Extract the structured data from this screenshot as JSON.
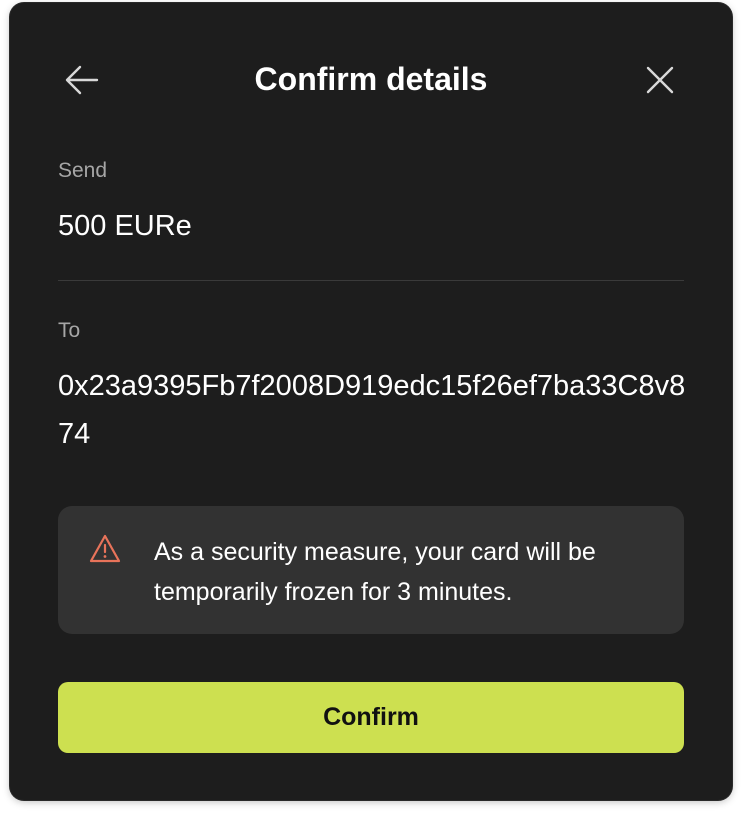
{
  "header": {
    "title": "Confirm details",
    "back_icon": "arrow-left-icon",
    "close_icon": "close-icon"
  },
  "send": {
    "label": "Send",
    "value": "500 EURe"
  },
  "to": {
    "label": "To",
    "value": "0x23a9395Fb7f2008D919edc15f26ef7ba33C8v874"
  },
  "warning": {
    "icon": "warning-triangle-icon",
    "text": "As a security measure, your card will be temporarily frozen for 3 minutes."
  },
  "actions": {
    "confirm_label": "Confirm"
  },
  "colors": {
    "background": "#1d1d1d",
    "warning_bg": "#323232",
    "accent": "#cde050",
    "warning_icon": "#e8735a",
    "label": "#a6a6a6"
  }
}
